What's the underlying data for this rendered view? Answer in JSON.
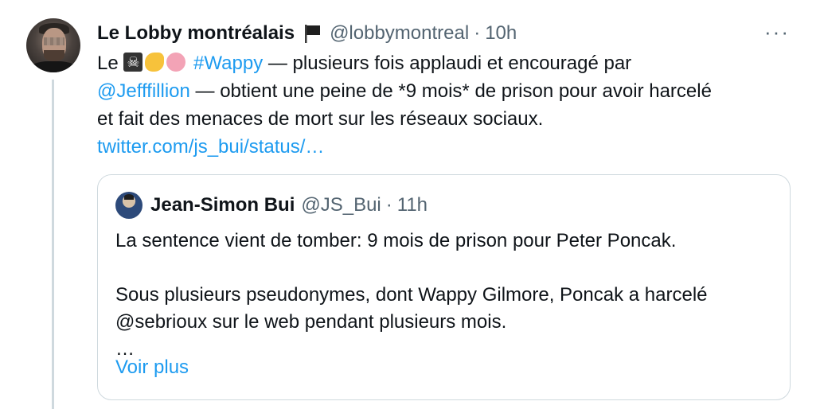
{
  "tweet": {
    "author_name": "Le Lobby montréalais",
    "handle": "@lobbymontreal",
    "separator": "·",
    "time": "10h",
    "more_label": "···",
    "lines": {
      "l1_prefix": "Le",
      "l1_hashtag": "#Wappy",
      "l1_rest": " — plusieurs fois applaudi et encouragé par",
      "l2_mention": "@Jefffillion",
      "l2_rest": " — obtient une peine de *9 mois* de prison pour avoir harcelé",
      "l3": "et fait des menaces de mort sur les réseaux sociaux.",
      "l4_link": "twitter.com/js_bui/status/…"
    },
    "emojis": [
      "pirate-flag-icon",
      "pointing-hand-icon",
      "brain-icon"
    ]
  },
  "quoted": {
    "author_name": "Jean-Simon Bui",
    "handle": "@JS_Bui",
    "separator": "·",
    "time": "11h",
    "line1": "La sentence vient de tomber: 9 mois de prison pour Peter Poncak.",
    "line2": "Sous plusieurs pseudonymes, dont Wappy Gilmore, Poncak a harcelé",
    "line3": "@sebrioux sur le web pendant plusieurs mois.",
    "ellipsis": "…",
    "show_more": "Voir plus"
  },
  "colors": {
    "link": "#1d9bf0",
    "muted": "#536471",
    "text": "#0f1419",
    "border": "#cfd9de"
  }
}
